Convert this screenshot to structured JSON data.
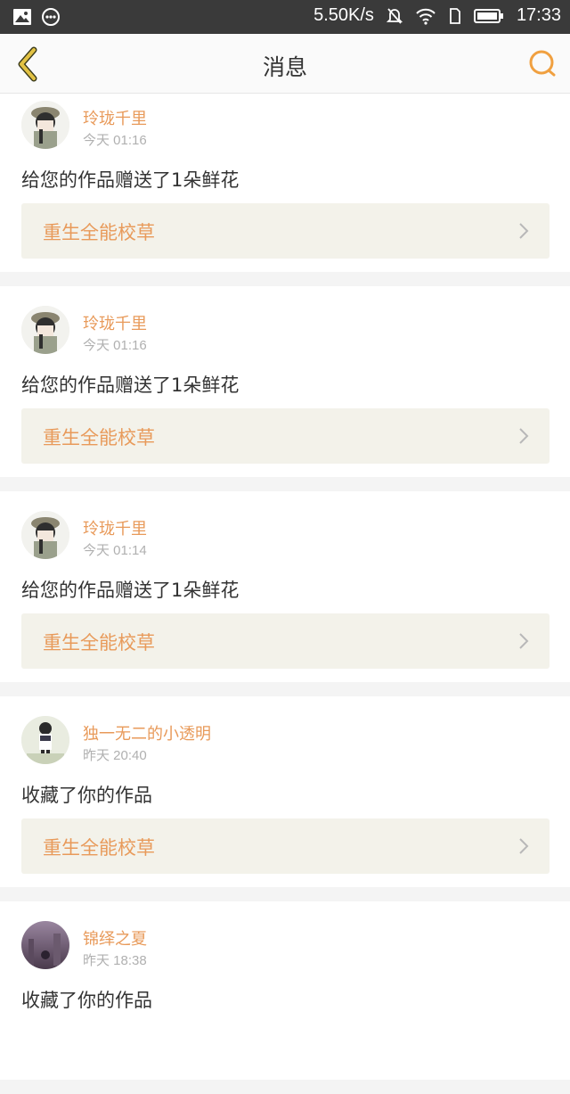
{
  "status_bar": {
    "network_speed": "5.50K/s",
    "time": "17:33",
    "icons": [
      "image-icon",
      "more-circle-icon",
      "mute-icon",
      "wifi-icon",
      "sim-icon",
      "battery-icon"
    ]
  },
  "header": {
    "title": "消息",
    "back_icon": "chevron-left-icon",
    "search_icon": "search-icon"
  },
  "colors": {
    "accent": "#e89a5a",
    "back_arrow": "#c9a21e",
    "status_bar_bg": "#3a3a3a",
    "card_link_bg": "#f3f2ea"
  },
  "messages": [
    {
      "username": "玲珑千里",
      "time": "今天 01:16",
      "text": "给您的作品赠送了1朵鲜花",
      "work_title": "重生全能校草",
      "avatar": "avatar-girl-hat"
    },
    {
      "username": "玲珑千里",
      "time": "今天 01:16",
      "text": "给您的作品赠送了1朵鲜花",
      "work_title": "重生全能校草",
      "avatar": "avatar-girl-hat"
    },
    {
      "username": "玲珑千里",
      "time": "今天 01:14",
      "text": "给您的作品赠送了1朵鲜花",
      "work_title": "重生全能校草",
      "avatar": "avatar-girl-hat"
    },
    {
      "username": "独一无二的小透明",
      "time": "昨天 20:40",
      "text": "收藏了你的作品",
      "work_title": "重生全能校草",
      "avatar": "avatar-girl-standing"
    },
    {
      "username": "锦绎之夏",
      "time": "昨天 18:38",
      "text": "收藏了你的作品",
      "work_title": "",
      "avatar": "avatar-purple-scene"
    }
  ]
}
